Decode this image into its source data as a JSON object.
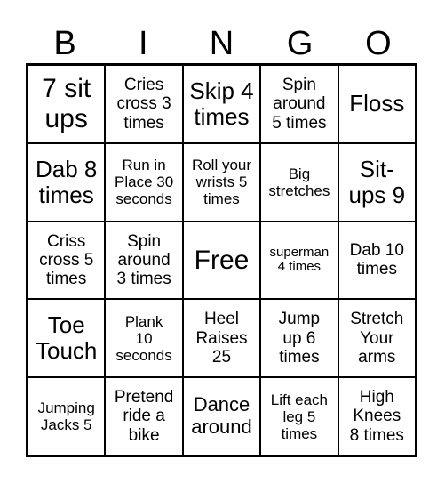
{
  "header": {
    "letters": [
      "B",
      "I",
      "N",
      "G",
      "O"
    ]
  },
  "board": {
    "rows": [
      [
        "7 sit\nups",
        "Cries\ncross 3\ntimes",
        "Skip 4\ntimes",
        "Spin\naround\n5 times",
        "Floss"
      ],
      [
        "Dab 8\ntimes",
        "Run in\nPlace 30\nseconds",
        "Roll your\nwrists 5\ntimes",
        "Big\nstretches",
        "Sit-\nups 9"
      ],
      [
        "Criss\ncross 5\ntimes",
        "Spin\naround\n3 times",
        "Free",
        "superman\n4 times",
        "Dab 10\ntimes"
      ],
      [
        "Toe\nTouch",
        "Plank\n10\nseconds",
        "Heel\nRaises\n25",
        "Jump\nup 6\ntimes",
        "Stretch\nYour\narms"
      ],
      [
        "Jumping\nJacks 5",
        "Pretend\nride a\nbike",
        "Dance\naround",
        "Lift each\nleg 5\ntimes",
        "High\nKnees\n8 times"
      ]
    ]
  }
}
